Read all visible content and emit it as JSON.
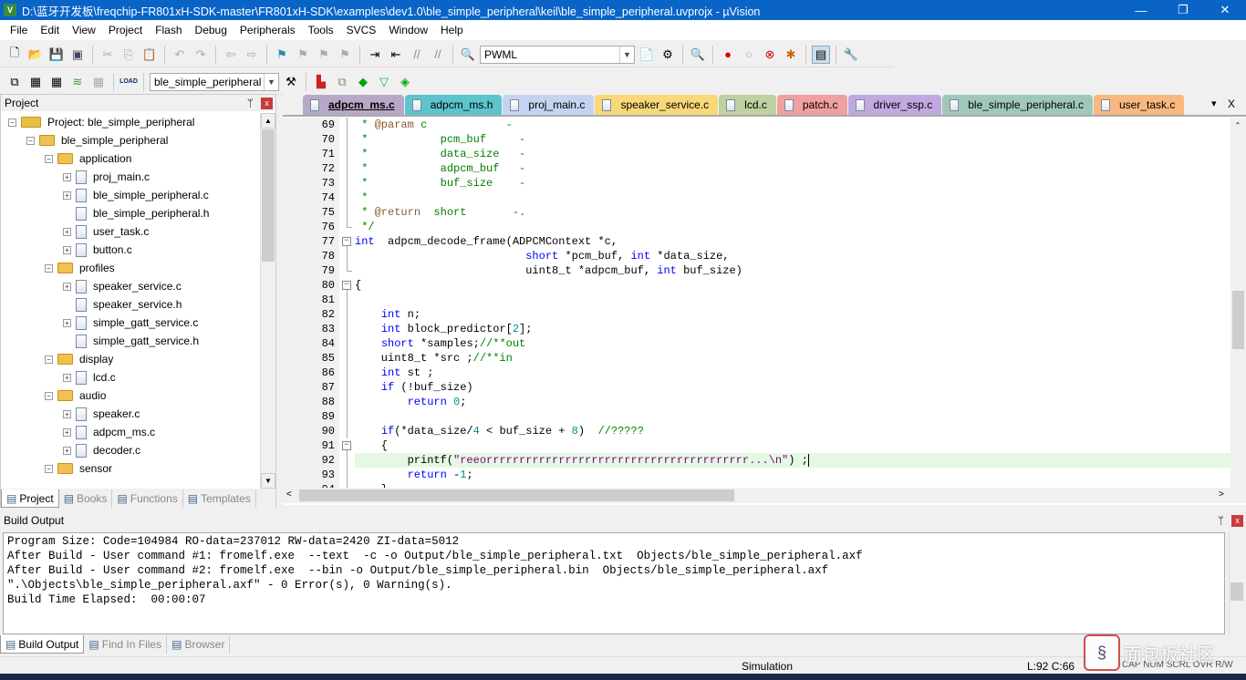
{
  "window": {
    "title": "D:\\蓝牙开发板\\freqchip-FR801xH-SDK-master\\FR801xH-SDK\\examples\\dev1.0\\ble_simple_peripheral\\keil\\ble_simple_peripheral.uvprojx - µVision",
    "app_icon": "uvision-icon",
    "minimize": "—",
    "restore": "❐",
    "close": "✕"
  },
  "menu": [
    "File",
    "Edit",
    "View",
    "Project",
    "Flash",
    "Debug",
    "Peripherals",
    "Tools",
    "SVCS",
    "Window",
    "Help"
  ],
  "toolbar1": {
    "find_combo": "PWML"
  },
  "toolbar2": {
    "target_combo": "ble_simple_peripheral",
    "load_label": "LOAD"
  },
  "project_panel": {
    "title": "Project",
    "pin": "ᛘ",
    "close": "x",
    "tree": [
      {
        "label": "Project: ble_simple_peripheral",
        "level": 0,
        "type": "project",
        "expand": "−"
      },
      {
        "label": "ble_simple_peripheral",
        "level": 1,
        "type": "target",
        "expand": "−"
      },
      {
        "label": "application",
        "level": 2,
        "type": "folder",
        "expand": "−"
      },
      {
        "label": "proj_main.c",
        "level": 3,
        "type": "file",
        "expand": "+"
      },
      {
        "label": "ble_simple_peripheral.c",
        "level": 3,
        "type": "file",
        "expand": "+"
      },
      {
        "label": "ble_simple_peripheral.h",
        "level": 3,
        "type": "file",
        "expand": ""
      },
      {
        "label": "user_task.c",
        "level": 3,
        "type": "file",
        "expand": "+"
      },
      {
        "label": "button.c",
        "level": 3,
        "type": "file",
        "expand": "+"
      },
      {
        "label": "profiles",
        "level": 2,
        "type": "folder",
        "expand": "−"
      },
      {
        "label": "speaker_service.c",
        "level": 3,
        "type": "file",
        "expand": "+"
      },
      {
        "label": "speaker_service.h",
        "level": 3,
        "type": "file",
        "expand": ""
      },
      {
        "label": "simple_gatt_service.c",
        "level": 3,
        "type": "file",
        "expand": "+"
      },
      {
        "label": "simple_gatt_service.h",
        "level": 3,
        "type": "file",
        "expand": ""
      },
      {
        "label": "display",
        "level": 2,
        "type": "folder",
        "expand": "−"
      },
      {
        "label": "lcd.c",
        "level": 3,
        "type": "file",
        "expand": "+"
      },
      {
        "label": "audio",
        "level": 2,
        "type": "folder",
        "expand": "−"
      },
      {
        "label": "speaker.c",
        "level": 3,
        "type": "file",
        "expand": "+"
      },
      {
        "label": "adpcm_ms.c",
        "level": 3,
        "type": "file",
        "expand": "+"
      },
      {
        "label": "decoder.c",
        "level": 3,
        "type": "file",
        "expand": "+"
      },
      {
        "label": "sensor",
        "level": 2,
        "type": "folder",
        "expand": "−"
      }
    ],
    "tabs": [
      {
        "label": "Project",
        "icon": "project-icon",
        "active": true
      },
      {
        "label": "Books",
        "icon": "books-icon"
      },
      {
        "label": "Functions",
        "icon": "functions-icon"
      },
      {
        "label": "Templates",
        "icon": "templates-icon"
      }
    ]
  },
  "editor": {
    "tabs": [
      {
        "label": "adpcm_ms.c",
        "color": "#b8a8c8",
        "active": true
      },
      {
        "label": "adpcm_ms.h",
        "color": "#5cc4cc"
      },
      {
        "label": "proj_main.c",
        "color": "#c4d4f0"
      },
      {
        "label": "speaker_service.c",
        "color": "#f8d878"
      },
      {
        "label": "lcd.c",
        "color": "#c0d0a0"
      },
      {
        "label": "patch.c",
        "color": "#f0a0a0"
      },
      {
        "label": "driver_ssp.c",
        "color": "#c0a8e0"
      },
      {
        "label": "ble_simple_peripheral.c",
        "color": "#a0c8b8"
      },
      {
        "label": "user_task.c",
        "color": "#f8b880"
      }
    ],
    "tab_menu": "▾",
    "tab_close": "X",
    "lines": [
      {
        "n": "69",
        "fold": "line",
        "t": [
          [
            "cm",
            " * "
          ],
          [
            "dt",
            "@param"
          ],
          [
            "cm",
            " c            -"
          ]
        ]
      },
      {
        "n": "70",
        "fold": "line",
        "t": [
          [
            "cm",
            " *           pcm_buf     -"
          ]
        ]
      },
      {
        "n": "71",
        "fold": "line",
        "t": [
          [
            "cm",
            " *           data_size   -"
          ]
        ]
      },
      {
        "n": "72",
        "fold": "line",
        "t": [
          [
            "cm",
            " *           adpcm_buf   -"
          ]
        ]
      },
      {
        "n": "73",
        "fold": "line",
        "t": [
          [
            "cm",
            " *           buf_size    -"
          ]
        ]
      },
      {
        "n": "74",
        "fold": "line",
        "t": [
          [
            "cm",
            " *"
          ]
        ]
      },
      {
        "n": "75",
        "fold": "line",
        "t": [
          [
            "cm",
            " * "
          ],
          [
            "dt",
            "@return"
          ],
          [
            "cm",
            "  short       -."
          ]
        ]
      },
      {
        "n": "76",
        "fold": "end",
        "t": [
          [
            "cm",
            " */"
          ]
        ]
      },
      {
        "n": "77",
        "fold": "box",
        "t": [
          [
            "kw",
            "int"
          ],
          [
            "",
            "  adpcm_decode_frame(ADPCMContext *c,"
          ]
        ]
      },
      {
        "n": "78",
        "fold": "line",
        "t": [
          [
            "",
            "                          "
          ],
          [
            "kw",
            "short"
          ],
          [
            "",
            " *pcm_buf, "
          ],
          [
            "kw",
            "int"
          ],
          [
            "",
            " *data_size,"
          ]
        ]
      },
      {
        "n": "79",
        "fold": "end",
        "t": [
          [
            "",
            "                          uint8_t *adpcm_buf, "
          ],
          [
            "kw",
            "int"
          ],
          [
            "",
            " buf_size)"
          ]
        ]
      },
      {
        "n": "80",
        "fold": "box",
        "t": [
          [
            "",
            "{"
          ]
        ]
      },
      {
        "n": "81",
        "fold": "line",
        "t": []
      },
      {
        "n": "82",
        "fold": "line",
        "t": [
          [
            "",
            "    "
          ],
          [
            "kw",
            "int"
          ],
          [
            "",
            " n;"
          ]
        ]
      },
      {
        "n": "83",
        "fold": "line",
        "t": [
          [
            "",
            "    "
          ],
          [
            "kw",
            "int"
          ],
          [
            "",
            " block_predictor["
          ],
          [
            "nm",
            "2"
          ],
          [
            "",
            "];"
          ]
        ]
      },
      {
        "n": "84",
        "fold": "line",
        "t": [
          [
            "",
            "    "
          ],
          [
            "kw",
            "short"
          ],
          [
            "",
            " *samples;"
          ],
          [
            "cm",
            "//**out"
          ]
        ]
      },
      {
        "n": "85",
        "fold": "line",
        "t": [
          [
            "",
            "    uint8_t *src ;"
          ],
          [
            "cm",
            "//**in"
          ]
        ]
      },
      {
        "n": "86",
        "fold": "line",
        "t": [
          [
            "",
            "    "
          ],
          [
            "kw",
            "int"
          ],
          [
            "",
            " st ;"
          ]
        ]
      },
      {
        "n": "87",
        "fold": "line",
        "t": [
          [
            "",
            "    "
          ],
          [
            "kw",
            "if"
          ],
          [
            "",
            " (!buf_size)"
          ]
        ]
      },
      {
        "n": "88",
        "fold": "line",
        "t": [
          [
            "",
            "        "
          ],
          [
            "kw",
            "return"
          ],
          [
            "",
            " "
          ],
          [
            "nm",
            "0"
          ],
          [
            "",
            ";"
          ]
        ]
      },
      {
        "n": "89",
        "fold": "line",
        "t": []
      },
      {
        "n": "90",
        "fold": "line",
        "t": [
          [
            "",
            "    "
          ],
          [
            "kw",
            "if"
          ],
          [
            "",
            "(*data_size/"
          ],
          [
            "nm",
            "4"
          ],
          [
            "",
            " < buf_size + "
          ],
          [
            "nm",
            "8"
          ],
          [
            "",
            ")  "
          ],
          [
            "cm",
            "//?????"
          ]
        ]
      },
      {
        "n": "91",
        "fold": "box",
        "t": [
          [
            "",
            "    {"
          ]
        ]
      },
      {
        "n": "92",
        "fold": "line",
        "hl": true,
        "t": [
          [
            "",
            "        printf("
          ],
          [
            "st",
            "\"reeorrrrrrrrrrrrrrrrrrrrrrrrrrrrrrrrrrrrrrrr...\\n\""
          ],
          [
            "",
            ") ;"
          ]
        ]
      },
      {
        "n": "93",
        "fold": "line",
        "t": [
          [
            "",
            "        "
          ],
          [
            "kw",
            "return"
          ],
          [
            "",
            " -"
          ],
          [
            "nm",
            "1"
          ],
          [
            "",
            ";"
          ]
        ]
      },
      {
        "n": "94",
        "fold": "line",
        "t": [
          [
            "",
            "    }"
          ]
        ]
      }
    ]
  },
  "build_output": {
    "title": "Build Output",
    "pin": "ᛘ",
    "close": "x",
    "lines": [
      "Program Size: Code=104984 RO-data=237012 RW-data=2420 ZI-data=5012",
      "After Build - User command #1: fromelf.exe  --text  -c -o Output/ble_simple_peripheral.txt  Objects/ble_simple_peripheral.axf",
      "After Build - User command #2: fromelf.exe  --bin -o Output/ble_simple_peripheral.bin  Objects/ble_simple_peripheral.axf",
      "\".\\Objects\\ble_simple_peripheral.axf\" - 0 Error(s), 0 Warning(s).",
      "Build Time Elapsed:  00:00:07"
    ],
    "tabs": [
      {
        "label": "Build Output",
        "icon": "build-output-icon",
        "active": true
      },
      {
        "label": "Find In Files",
        "icon": "find-in-files-icon"
      },
      {
        "label": "Browser",
        "icon": "browser-icon"
      }
    ]
  },
  "status": {
    "mode": "Simulation",
    "position": "L:92 C:66",
    "flags": "CAP NUM SCRL OVR R/W",
    "watermark": "面包板社区"
  }
}
